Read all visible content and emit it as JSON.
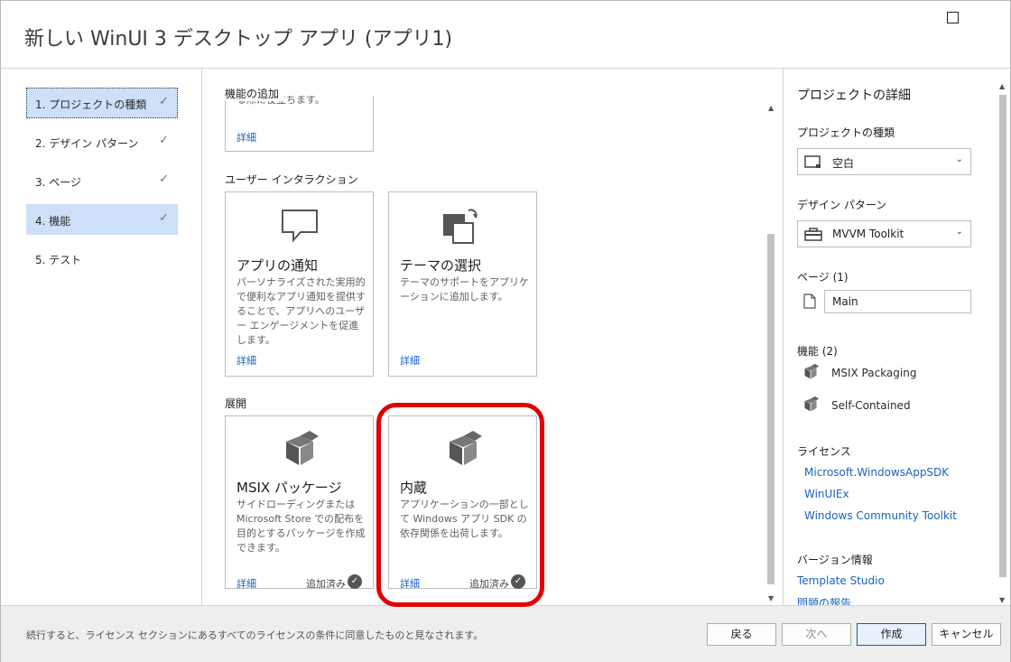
{
  "window": {
    "title": "新しい WinUI 3 デスクトップ アプリ (アプリ1)"
  },
  "nav": {
    "items": [
      {
        "label": "1. プロジェクトの種類",
        "check": "✓"
      },
      {
        "label": "2. デザイン パターン",
        "check": "✓"
      },
      {
        "label": "3. ページ",
        "check": "✓"
      },
      {
        "label": "4. 機能",
        "check": "✓"
      },
      {
        "label": "5. テスト",
        "check": ""
      }
    ]
  },
  "content": {
    "section_features": "機能の追加",
    "top_card": {
      "partial_text": "る際に役立ちます。",
      "link": "詳細"
    },
    "section_ui": "ユーザー インタラクション",
    "ui_cards": [
      {
        "icon": "chat-bubble-icon",
        "title": "アプリの通知",
        "desc": "パーソナライズされた実用的で便利なアプリ通知を提供することで、アプリへのユーザー エンゲージメントを促進します。",
        "link": "詳細"
      },
      {
        "icon": "theme-icon",
        "title": "テーマの選択",
        "desc": "テーマのサポートをアプリケーションに追加します。",
        "link": "詳細"
      }
    ],
    "section_deploy": "展開",
    "deploy_cards": [
      {
        "icon": "package-icon",
        "title": "MSIX パッケージ",
        "desc": "サイドローディングまたは Microsoft Store での配布を目的とするパッケージを作成できます。",
        "link": "詳細",
        "status": "追加済み"
      },
      {
        "icon": "package-icon",
        "title": "内蔵",
        "desc": "アプリケーションの一部として Windows アプリ SDK の依存関係を出荷します。",
        "link": "詳細",
        "status": "追加済み"
      }
    ]
  },
  "details": {
    "heading": "プロジェクトの詳細",
    "project_type_label": "プロジェクトの種類",
    "project_type_value": "空白",
    "design_pattern_label": "デザイン パターン",
    "design_pattern_value": "MVVM Toolkit",
    "pages_label": "ページ (1)",
    "page_value": "Main",
    "features_label": "機能 (2)",
    "features": [
      "MSIX Packaging",
      "Self-Contained"
    ],
    "license_label": "ライセンス",
    "licenses": [
      "Microsoft.WindowsAppSDK",
      "WinUIEx",
      "Windows Community Toolkit"
    ],
    "version_label": "バージョン情報",
    "version_links": [
      "Template Studio",
      "問題の報告"
    ]
  },
  "footer": {
    "note": "続行すると、ライセンス セクションにあるすべてのライセンスの条件に同意したものと見なされます。",
    "back": "戻る",
    "next": "次へ",
    "create": "作成",
    "cancel": "キャンセル"
  },
  "colors": {
    "accent": "#1a63c1",
    "selected_nav": "#cde0f7",
    "highlight": "#e00000"
  }
}
